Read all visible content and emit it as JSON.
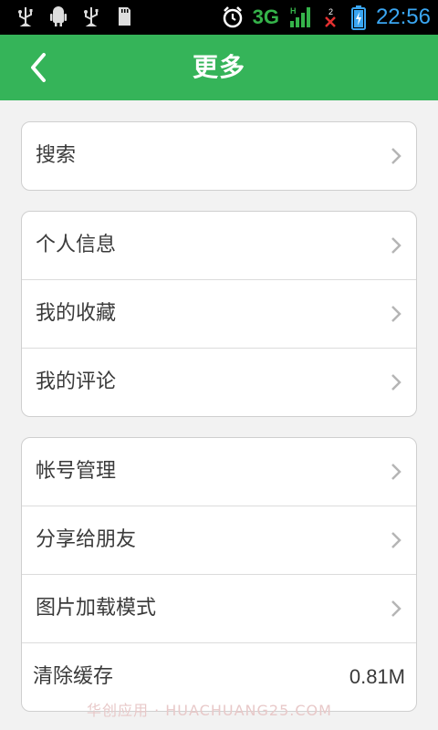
{
  "status_bar": {
    "icons": [
      "usb-icon",
      "android-debug-icon",
      "usb-icon",
      "sd-card-icon"
    ],
    "network": "3G",
    "time": "22:56",
    "colors": {
      "time": "#3aa6f2",
      "signal": "#35b34a"
    }
  },
  "header": {
    "title": "更多",
    "back_icon": "chevron-left-icon",
    "color": "#35b459"
  },
  "groups": [
    {
      "items": [
        {
          "label": "搜索"
        }
      ]
    },
    {
      "items": [
        {
          "label": "个人信息"
        },
        {
          "label": "我的收藏"
        },
        {
          "label": "我的评论"
        }
      ]
    },
    {
      "items": [
        {
          "label": "帐号管理"
        },
        {
          "label": "分享给朋友"
        },
        {
          "label": "图片加载模式"
        },
        {
          "label": "清除缓存",
          "value": "0.81M"
        }
      ]
    }
  ],
  "watermark": "华创应用 · HUACHUANG25.COM"
}
